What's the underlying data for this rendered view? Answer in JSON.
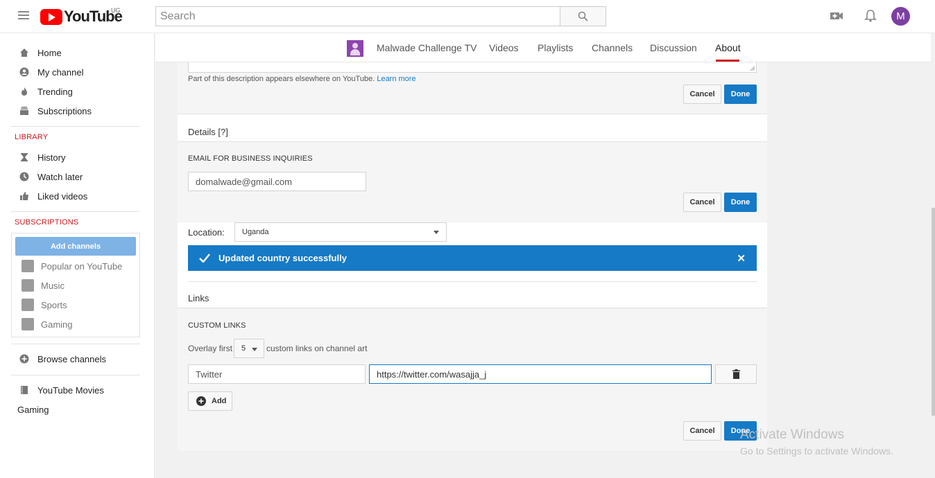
{
  "header": {
    "logo_text": "YouTube",
    "country_code": "UG",
    "search_placeholder": "Search",
    "avatar_letter": "M"
  },
  "sidebar": {
    "main_items": [
      {
        "label": "Home",
        "icon": "home-icon"
      },
      {
        "label": "My channel",
        "icon": "account-icon"
      },
      {
        "label": "Trending",
        "icon": "flame-icon"
      },
      {
        "label": "Subscriptions",
        "icon": "subscriptions-icon"
      }
    ],
    "library_heading": "LIBRARY",
    "library_items": [
      {
        "label": "History",
        "icon": "hourglass-icon"
      },
      {
        "label": "Watch later",
        "icon": "clock-icon"
      },
      {
        "label": "Liked videos",
        "icon": "thumb-up-icon"
      }
    ],
    "subscriptions_heading": "SUBSCRIPTIONS",
    "add_channels_label": "Add channels",
    "subscription_items": [
      {
        "label": "Popular on YouTube"
      },
      {
        "label": "Music"
      },
      {
        "label": "Sports"
      },
      {
        "label": "Gaming"
      }
    ],
    "browse_channels": "Browse channels",
    "youtube_movies": "YouTube Movies",
    "gaming": "Gaming"
  },
  "channel_nav": {
    "channel_name": "Malwade Challenge TV",
    "tabs": [
      "Videos",
      "Playlists",
      "Channels",
      "Discussion",
      "About"
    ],
    "active_tab": "About"
  },
  "about": {
    "description_note": "Part of this description appears elsewhere on YouTube.",
    "learn_more": "Learn more",
    "cancel_label": "Cancel",
    "done_label": "Done",
    "details_title": "Details [?]",
    "email_label": "EMAIL FOR BUSINESS INQUIRIES",
    "email_value": "domalwade@gmail.com",
    "location_label": "Location:",
    "location_value": "Uganda",
    "banner_message": "Updated country successfully",
    "links_title": "Links",
    "custom_links_label": "CUSTOM LINKS",
    "overlay_prefix": "Overlay first",
    "overlay_count": "5",
    "overlay_suffix": "custom links on channel art",
    "link_title_value": "Twitter",
    "link_url_value": "https://twitter.com/wasajja_j",
    "add_label": "Add"
  },
  "watermark": {
    "line1": "Activate Windows",
    "line2": "Go to Settings to activate Windows."
  }
}
